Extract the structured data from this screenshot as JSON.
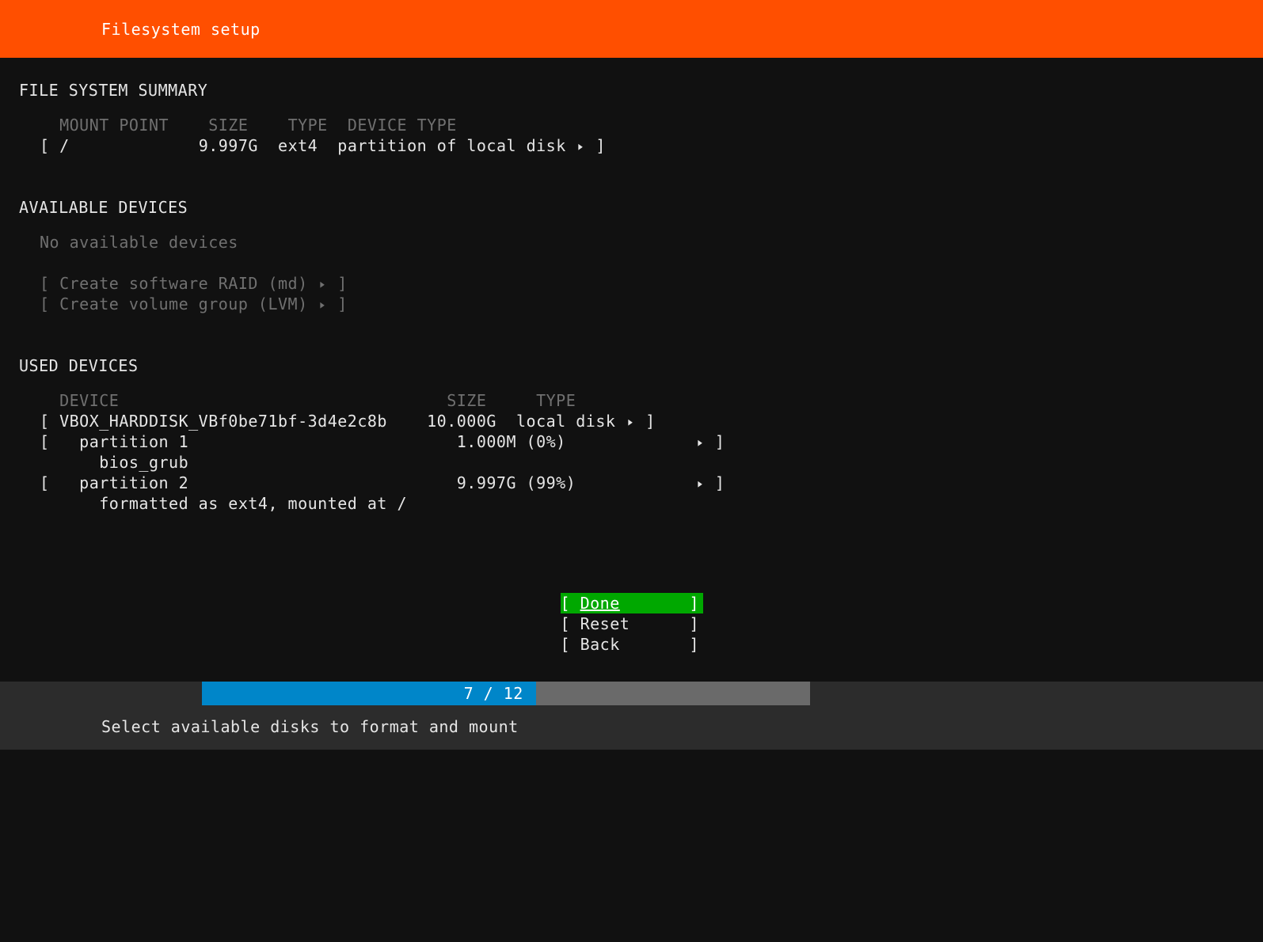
{
  "header": {
    "title": "Filesystem setup"
  },
  "summary": {
    "heading": "FILE SYSTEM SUMMARY",
    "cols": {
      "mount": "MOUNT POINT",
      "size": "SIZE",
      "type": "TYPE",
      "devtype": "DEVICE TYPE"
    },
    "row": {
      "mount": "/",
      "size": "9.997G",
      "type": "ext4",
      "devtype": "partition of local disk"
    }
  },
  "avail": {
    "heading": "AVAILABLE DEVICES",
    "none": "No available devices",
    "raid": "Create software RAID (md)",
    "lvm": "Create volume group (LVM)"
  },
  "used": {
    "heading": "USED DEVICES",
    "cols": {
      "device": "DEVICE",
      "size": "SIZE",
      "type": "TYPE"
    },
    "disk": {
      "name": "VBOX_HARDDISK_VBf0be71bf-3d4e2c8b",
      "size": "10.000G",
      "type": "local disk"
    },
    "p1": {
      "name": "partition 1",
      "size": "1.000M",
      "pct": "(0%)",
      "sub": "bios_grub"
    },
    "p2": {
      "name": "partition 2",
      "size": "9.997G",
      "pct": "(99%)",
      "sub": "formatted as ext4, mounted at /"
    }
  },
  "buttons": {
    "done": "Done",
    "reset": "Reset",
    "back": "Back"
  },
  "progress": {
    "text": "7 / 12",
    "pct": 55
  },
  "footer": {
    "hint": "Select available disks to format and mount"
  }
}
